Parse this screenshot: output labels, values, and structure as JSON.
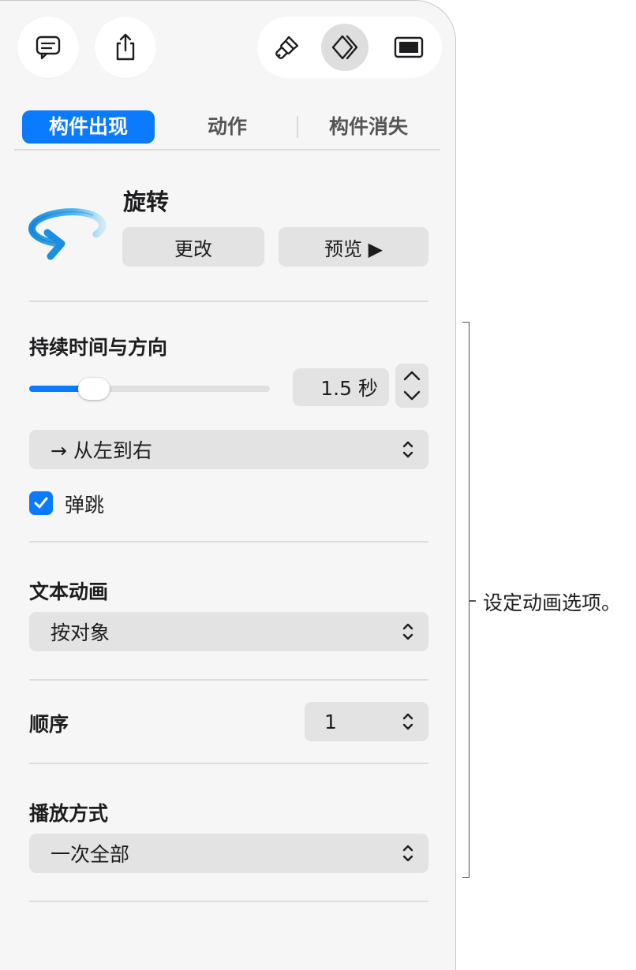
{
  "toolbar": {
    "left_buttons": [
      {
        "icon": "comment-icon"
      },
      {
        "icon": "share-icon"
      }
    ],
    "segmented": [
      {
        "icon": "paintbrush-icon",
        "active": false
      },
      {
        "icon": "animate-icon",
        "active": true
      },
      {
        "icon": "document-icon",
        "active": false
      }
    ]
  },
  "tabs": [
    {
      "label": "构件出现",
      "active": true
    },
    {
      "label": "动作",
      "active": false
    },
    {
      "label": "构件消失",
      "active": false
    }
  ],
  "animation": {
    "icon": "rotate-arrow-icon",
    "title": "旋转",
    "change_label": "更改",
    "preview_label": "预览 ▶"
  },
  "duration_section": {
    "title": "持续时间与方向",
    "slider_value_fraction": 0.27,
    "duration_value": "1.5 秒",
    "direction": "→ 从左到右",
    "bounce_label": "弹跳",
    "bounce_checked": true
  },
  "text_animation": {
    "title": "文本动画",
    "value": "按对象"
  },
  "order": {
    "label": "顺序",
    "value": "1"
  },
  "playback": {
    "title": "播放方式",
    "value": "一次全部"
  },
  "callout": {
    "text": "设定动画选项。"
  },
  "colors": {
    "accent": "#0a7aff",
    "panel": "#f6f6f6",
    "control": "#e3e3e3"
  }
}
